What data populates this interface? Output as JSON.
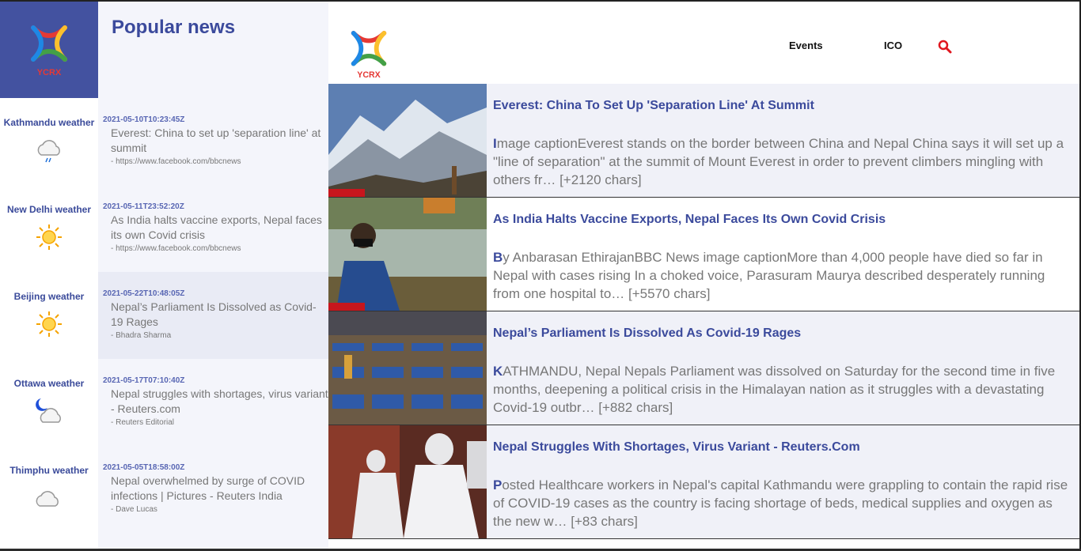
{
  "brand": {
    "name": "YCRX"
  },
  "popular": {
    "title": "Popular news",
    "items": [
      {
        "date": "2021-05-10T10:23:45Z",
        "title": "Everest: China to set up 'separation line' at summit",
        "source": "- https://www.facebook.com/bbcnews"
      },
      {
        "date": "2021-05-11T23:52:20Z",
        "title": "As India halts vaccine exports, Nepal faces its own Covid crisis",
        "source": "- https://www.facebook.com/bbcnews"
      },
      {
        "date": "2021-05-22T10:48:05Z",
        "title": "Nepal’s Parliament Is Dissolved as Covid-19 Rages",
        "source": "- Bhadra Sharma"
      },
      {
        "date": "2021-05-17T07:10:40Z",
        "title": "Nepal struggles with shortages, virus variant - Reuters.com",
        "source": "- Reuters Editorial"
      },
      {
        "date": "2021-05-05T18:58:00Z",
        "title": "Nepal overwhelmed by surge of COVID infections | Pictures - Reuters India",
        "source": "- Dave Lucas"
      }
    ]
  },
  "weather": {
    "items": [
      {
        "label": "Kathmandu weather",
        "icon": "rain-cloud-icon"
      },
      {
        "label": "New Delhi weather",
        "icon": "sun-icon"
      },
      {
        "label": "Beijing weather",
        "icon": "sun-icon"
      },
      {
        "label": "Ottawa weather",
        "icon": "moon-cloud-icon"
      },
      {
        "label": "Thimphu weather",
        "icon": "cloud-icon"
      }
    ]
  },
  "nav": {
    "events": "Events",
    "ico": "ICO",
    "search_icon": "search-icon"
  },
  "articles": [
    {
      "title": "Everest: China To Set Up 'Separation Line' At Summit",
      "first_letter": "I",
      "body": "mage captionEverest stands on the border between China and Nepal China says it will set up a \"line of separation\" at the summit of Mount Everest in order to prevent climbers mingling with others fr… [+2120 chars]"
    },
    {
      "title": "As India Halts Vaccine Exports, Nepal Faces Its Own Covid Crisis",
      "first_letter": "B",
      "body": "y Anbarasan EthirajanBBC News image captionMore than 4,000 people have died so far in Nepal with cases rising In a choked voice, Parasuram Maurya described desperately running from one hospital to… [+5570 chars]"
    },
    {
      "title": "Nepal’s Parliament Is Dissolved As Covid-19 Rages",
      "first_letter": "K",
      "body": "ATHMANDU, Nepal Nepals Parliament was dissolved on Saturday for the second time in five months, deepening a political crisis in the Himalayan nation as it struggles with a devastating Covid-19 outbr… [+882 chars]"
    },
    {
      "title": "Nepal Struggles With Shortages, Virus Variant - Reuters.Com",
      "first_letter": "P",
      "body": "osted Healthcare workers in Nepal's capital Kathmandu were grappling to contain the rapid rise of COVID-19 cases as the country is facing shortage of beds, medical supplies and oxygen as the new w… [+83 chars]"
    }
  ],
  "colors": {
    "accent": "#3b4a9c",
    "logo_bg": "#4352a0",
    "search": "#e0161e"
  }
}
